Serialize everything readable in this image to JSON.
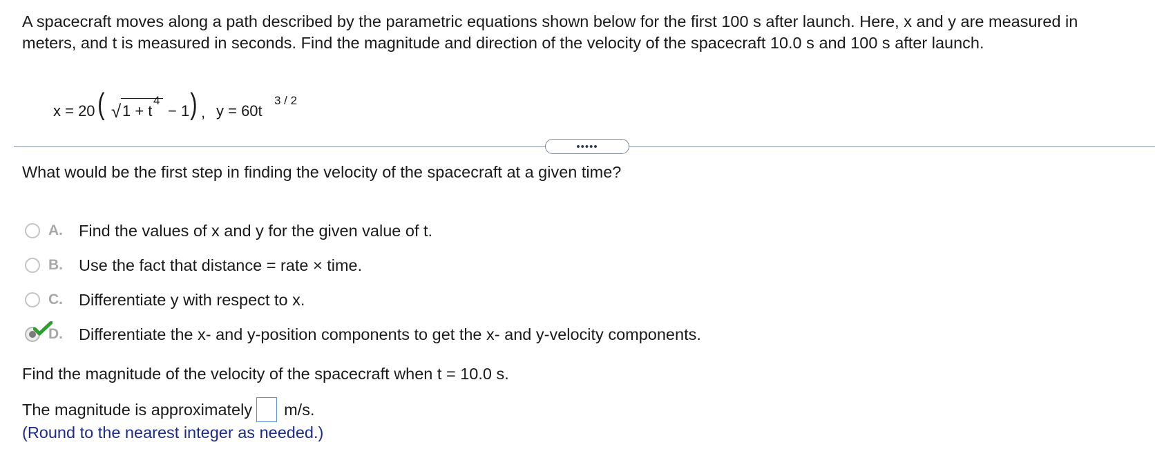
{
  "problem": {
    "text": "A spacecraft moves along a path described by the parametric equations shown below for the first 100 s after launch. Here, x and y are measured in meters, and t is measured in seconds. Find the magnitude and direction of the velocity of the spacecraft 10.0 s and 100 s after launch."
  },
  "equation": {
    "x_lhs": "x = 20",
    "open_paren": "(",
    "sqrt_symbol": "√",
    "radicand": "1 + t",
    "radicand_exp": "4",
    "minus_one": "− 1",
    "close_paren": ")",
    "comma": ",",
    "y_lhs": "y = 60t",
    "y_exp": "3 / 2"
  },
  "divider": {
    "expand_label": "•••••"
  },
  "question": "What would be the first step in finding the velocity of the spacecraft at a given time?",
  "options": [
    {
      "letter": "A.",
      "text": "Find the values of x and y for the given value of t.",
      "selected": false
    },
    {
      "letter": "B.",
      "text": "Use the fact that distance = rate × time.",
      "selected": false
    },
    {
      "letter": "C.",
      "text": "Differentiate y with respect to x.",
      "selected": false
    },
    {
      "letter": "D.",
      "text": "Differentiate the x- and y-position components to get the x- and y-velocity components.",
      "selected": true,
      "correct": true
    }
  ],
  "part2": {
    "prompt": "Find the magnitude of the velocity of the spacecraft when t = 10.0 s.",
    "answer_prefix": "The magnitude is approximately",
    "answer_value": "",
    "answer_unit": "m/s.",
    "hint": "(Round to the nearest integer as needed.)"
  },
  "colors": {
    "hint": "#1b2a8c",
    "check": "#2e9e2e",
    "answer_border": "#5b8ed2"
  }
}
